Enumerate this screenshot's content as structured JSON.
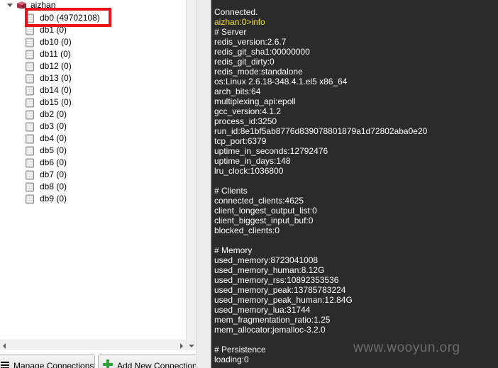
{
  "tree": {
    "server_name": "aizhan",
    "databases": [
      {
        "label": "db0 (49702108)",
        "highlighted": true
      },
      {
        "label": "db1 (0)"
      },
      {
        "label": "db10 (0)"
      },
      {
        "label": "db11 (0)"
      },
      {
        "label": "db12 (0)"
      },
      {
        "label": "db13 (0)"
      },
      {
        "label": "db14 (0)"
      },
      {
        "label": "db15 (0)"
      },
      {
        "label": "db2 (0)"
      },
      {
        "label": "db3 (0)"
      },
      {
        "label": "db4 (0)"
      },
      {
        "label": "db5 (0)"
      },
      {
        "label": "db6 (0)"
      },
      {
        "label": "db7 (0)"
      },
      {
        "label": "db8 (0)"
      },
      {
        "label": "db9 (0)"
      }
    ]
  },
  "buttons": {
    "manage_connections": "Manage Connections",
    "add_new_connection": "Add New Connection"
  },
  "console": {
    "lines": [
      "Connected.",
      "aizhan:0>info",
      "# Server",
      "redis_version:2.6.7",
      "redis_git_sha1:00000000",
      "redis_git_dirty:0",
      "redis_mode:standalone",
      "os:Linux 2.6.18-348.4.1.el5 x86_64",
      "arch_bits:64",
      "multiplexing_api:epoll",
      "gcc_version:4.1.2",
      "process_id:3250",
      "run_id:8e1bf5ab8776d839078801879a1d72802aba0e20",
      "tcp_port:6379",
      "uptime_in_seconds:12792476",
      "uptime_in_days:148",
      "lru_clock:1036800",
      "",
      "# Clients",
      "connected_clients:4625",
      "client_longest_output_list:0",
      "client_biggest_input_buf:0",
      "blocked_clients:0",
      "",
      "# Memory",
      "used_memory:8723041008",
      "used_memory_human:8.12G",
      "used_memory_rss:10892353536",
      "used_memory_peak:13785783224",
      "used_memory_peak_human:12.84G",
      "used_memory_lua:31744",
      "mem_fragmentation_ratio:1.25",
      "mem_allocator:jemalloc-3.2.0",
      "",
      "# Persistence",
      "loading:0"
    ],
    "prompt_line_index": 1,
    "text_color": "#ffffff",
    "prompt_color": "#f0e03a",
    "background": "#2b2b2b"
  },
  "watermark": "www.wooyun.org",
  "colors": {
    "highlight_border": "#e8141a"
  }
}
